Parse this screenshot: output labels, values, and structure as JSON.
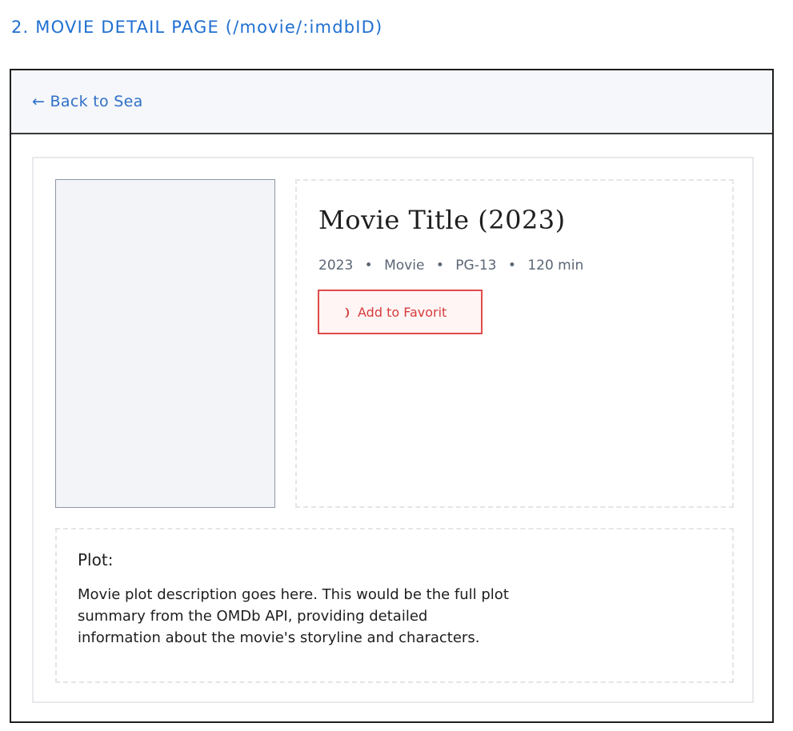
{
  "page": {
    "section_heading": "2. MOVIE DETAIL PAGE (/movie/:imdbID)"
  },
  "header": {
    "back_link": "← Back to Sea"
  },
  "movie": {
    "title": "Movie Title (2023)",
    "meta": {
      "year": "2023",
      "type": "Movie",
      "rating": "PG-13",
      "runtime": "120 min",
      "separator": "•"
    },
    "favorite_button": {
      "icon": "heart-icon",
      "label": "Add to Favorit"
    }
  },
  "plot": {
    "heading": "Plot:",
    "text": "Movie plot description goes here. This would be the full plot summary from the OMDb API, providing detailed information about the movie's storyline and characters."
  },
  "colors": {
    "accent_blue": "#1f6fd1",
    "favorite_red": "#e14b4b"
  }
}
